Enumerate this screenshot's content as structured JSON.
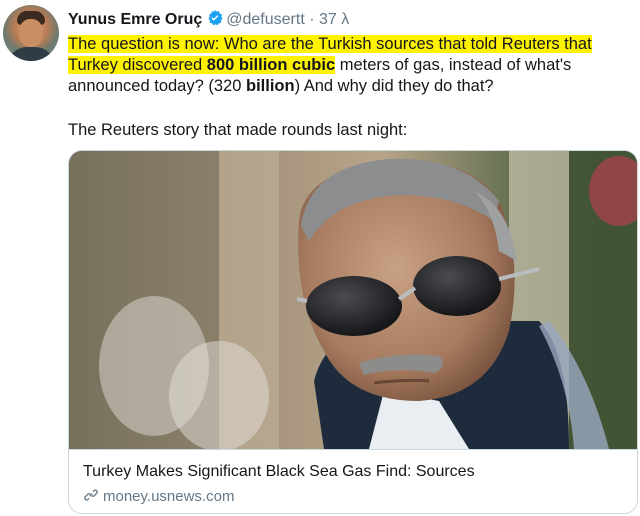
{
  "tweet": {
    "author_name": "Yunus Emre Oruç",
    "handle": "@defusertt",
    "separator": "·",
    "time": "37 λ",
    "text": {
      "p1": "The question is now: Who are the ",
      "p2": "Turkish sources that told Reuters that",
      "p3": "Turkey discovered ",
      "p4_bold": "800 billion cubic",
      "p5": " meters of gas, instead of what's announced today? (320 ",
      "p6_bold": "billion",
      "p7": ") And why did they do that?"
    },
    "quote_intro": "The Reuters story that made rounds last night:"
  },
  "card": {
    "title": "Turkey Makes Significant Black Sea Gas Find: Sources",
    "domain": "money.usnews.com"
  },
  "colors": {
    "highlight": "#fff200",
    "verified": "#1da1f2",
    "muted": "#657786"
  },
  "icons": [
    "verified-badge-icon",
    "link-icon"
  ]
}
